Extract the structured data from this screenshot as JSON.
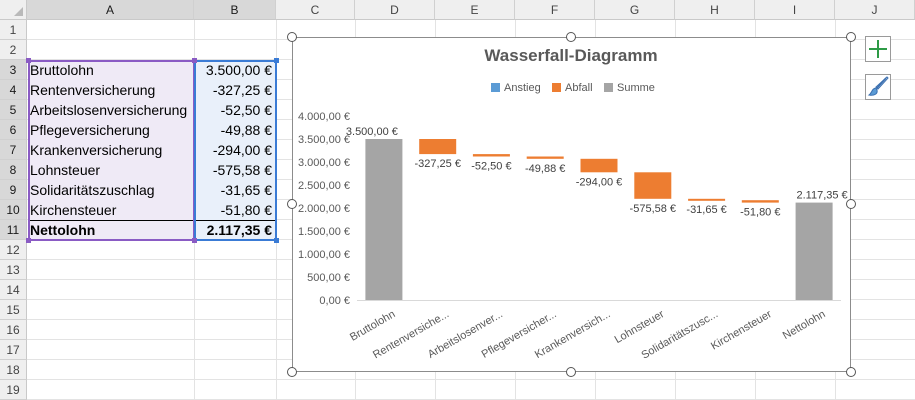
{
  "sheet": {
    "columns": [
      "A",
      "B",
      "C",
      "D",
      "E",
      "F",
      "G",
      "H",
      "I",
      "J"
    ],
    "rows": [
      "1",
      "2",
      "3",
      "4",
      "5",
      "6",
      "7",
      "8",
      "9",
      "10",
      "11",
      "12",
      "13",
      "14",
      "15",
      "16",
      "17",
      "18",
      "19"
    ],
    "data": [
      {
        "label": "Bruttolohn",
        "value": "3.500,00 €"
      },
      {
        "label": "Rentenversicherung",
        "value": "-327,25 €"
      },
      {
        "label": "Arbeitslosenversicherung",
        "value": "-52,50 €"
      },
      {
        "label": "Pflegeversicherung",
        "value": "-49,88 €"
      },
      {
        "label": "Krankenversicherung",
        "value": "-294,00 €"
      },
      {
        "label": "Lohnsteuer",
        "value": "-575,58 €"
      },
      {
        "label": "Solidaritätszuschlag",
        "value": "-31,65 €"
      },
      {
        "label": "Kirchensteuer",
        "value": "-51,80 €"
      },
      {
        "label": "Nettolohn",
        "value": "2.117,35 €"
      }
    ]
  },
  "colors": {
    "increase": "#5b9bd5",
    "decrease": "#ed7d31",
    "total": "#a5a5a5",
    "selection_a": "#8a5bc4",
    "selection_b": "#3a7bd5"
  },
  "side_buttons": [
    {
      "icon": "plus-icon",
      "name": "chart-elements-button"
    },
    {
      "icon": "brush-icon",
      "name": "chart-styles-button"
    }
  ],
  "chart_data": {
    "type": "waterfall",
    "title": "Wasserfall-Diagramm",
    "legend": [
      "Anstieg",
      "Abfall",
      "Summe"
    ],
    "legend_position": "top",
    "categories": [
      "Bruttolohn",
      "Rentenversiche...",
      "Arbeitslosenver...",
      "Pflegeversicher...",
      "Krankenversich...",
      "Lohnsteuer",
      "Solidaritätszusc...",
      "Kirchensteuer",
      "Nettolohn"
    ],
    "values": [
      3500.0,
      -327.25,
      -52.5,
      -49.88,
      -294.0,
      -575.58,
      -31.65,
      -51.8,
      2117.35
    ],
    "kinds": [
      "total",
      "decrease",
      "decrease",
      "decrease",
      "decrease",
      "decrease",
      "decrease",
      "decrease",
      "total"
    ],
    "data_labels": [
      "3.500,00 €",
      "-327,25 €",
      "-52,50 €",
      "-49,88 €",
      "-294,00 €",
      "-575,58 €",
      "-31,65 €",
      "-51,80 €",
      "2.117,35 €"
    ],
    "y_ticks": [
      0,
      500,
      1000,
      1500,
      2000,
      2500,
      3000,
      3500,
      4000
    ],
    "y_tick_labels": [
      "0,00 €",
      "500,00 €",
      "1.000,00 €",
      "1.500,00 €",
      "2.000,00 €",
      "2.500,00 €",
      "3.000,00 €",
      "3.500,00 €",
      "4.000,00 €"
    ],
    "ylim": [
      0,
      4000
    ],
    "grid": false
  }
}
